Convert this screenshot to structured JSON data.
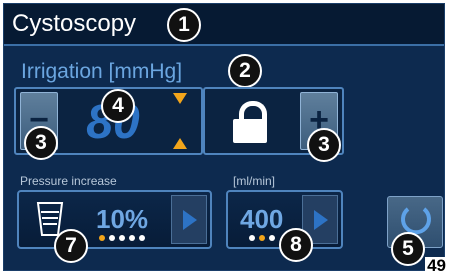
{
  "header": {
    "title": "Cystoscopy",
    "badge": "1"
  },
  "irrigation": {
    "title": "Irrigation [mmHg]",
    "title_badge": "2",
    "value": "80",
    "value_badge": "4",
    "minus_label": "−",
    "plus_label": "+",
    "minus_badge": "3",
    "plus_badge": "3",
    "lock_icon": "lock-icon",
    "arrow_icons": [
      "arrow-down-icon",
      "arrow-up-icon"
    ]
  },
  "pressure_increase": {
    "label": "Pressure increase",
    "value": "10%",
    "badge": "7",
    "active_dot": 0,
    "dot_count": 5
  },
  "flow": {
    "label": "[ml/min]",
    "value": "400",
    "badge": "8",
    "active_dot": 1,
    "dot_count": 3
  },
  "reset": {
    "icon": "reset-icon",
    "badge": "5"
  },
  "page_number": "49",
  "colors": {
    "background": "#0d2a4f",
    "accent": "#2d73c5",
    "highlight": "#f2a51b",
    "label": "#6ba6e0"
  }
}
